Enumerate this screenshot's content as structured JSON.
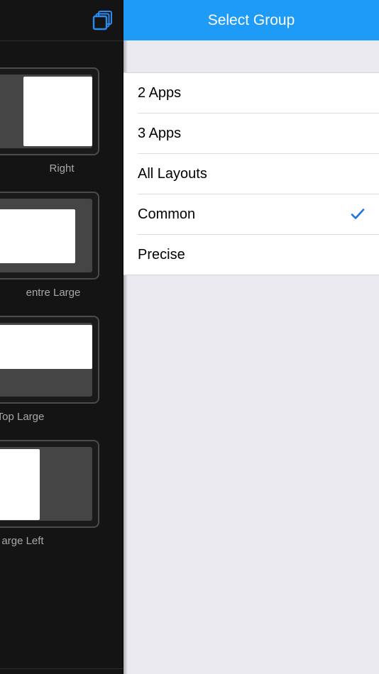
{
  "left_panel": {
    "layouts": [
      {
        "label": "Right"
      },
      {
        "label": "entre Large"
      },
      {
        "label": "Top Large"
      },
      {
        "label": "arge Left"
      }
    ]
  },
  "popover": {
    "title": "Select Group",
    "groups": [
      {
        "label": "2 Apps",
        "selected": false
      },
      {
        "label": "3 Apps",
        "selected": false
      },
      {
        "label": "All Layouts",
        "selected": false
      },
      {
        "label": "Common",
        "selected": true
      },
      {
        "label": "Precise",
        "selected": false
      }
    ]
  },
  "colors": {
    "accent": "#1d9bf6",
    "check": "#1a73e8",
    "panel_bg": "#141414"
  },
  "icons": {
    "toolbar": "stack-windows-icon",
    "selected": "checkmark-icon"
  }
}
